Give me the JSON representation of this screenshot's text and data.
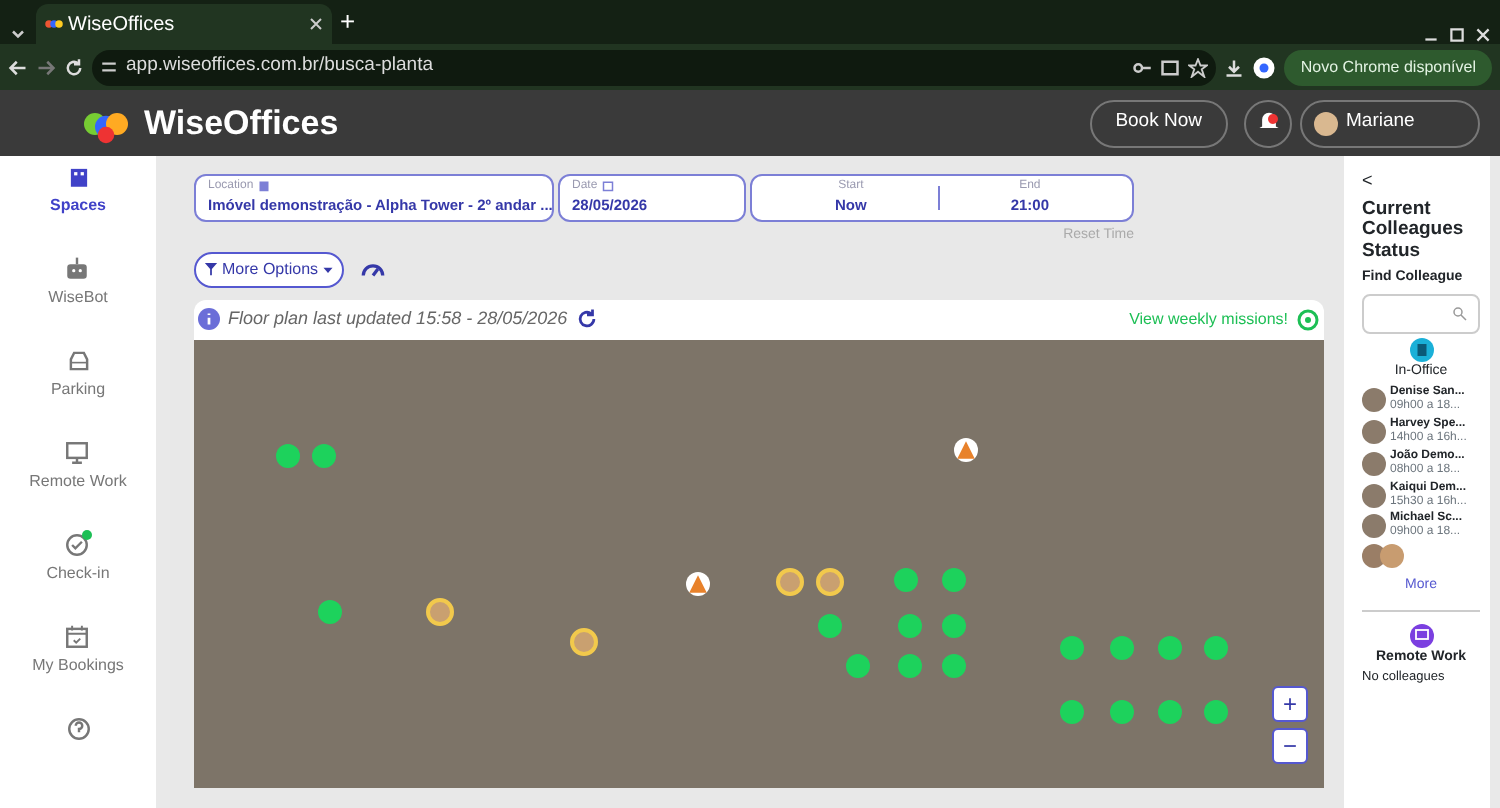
{
  "browser": {
    "tab_title": "WiseOffices",
    "new_tab": "+",
    "url": "app.wiseoffices.com.br/busca-planta",
    "update_label": "Novo Chrome disponível"
  },
  "header": {
    "logo": "WiseOffices",
    "book_button": "Book Now",
    "notification": true,
    "user": "Mariane"
  },
  "sidebar": {
    "items": [
      {
        "label": "Spaces",
        "selected": true,
        "badge": false
      },
      {
        "label": "WiseBot",
        "selected": false,
        "badge": false
      },
      {
        "label": "Parking",
        "selected": false,
        "badge": false
      },
      {
        "label": "Remote Work",
        "selected": false,
        "badge": false
      },
      {
        "label": "Check-in",
        "selected": false,
        "badge": true
      },
      {
        "label": "My Bookings",
        "selected": false,
        "badge": false
      }
    ]
  },
  "filters": {
    "location": {
      "label": "Location",
      "value": "Imóvel demonstração - Alpha Tower - 2º andar ..."
    },
    "date": {
      "label": "Date",
      "value": "28/05/2026"
    },
    "start": {
      "label": "Start",
      "value": "Now"
    },
    "end": {
      "label": "End",
      "value": "21:00"
    },
    "reset": "Reset Time",
    "more_options": "More Options"
  },
  "floor_plan": {
    "updated": "Floor plan last updated 15:58 - 28/05/2026",
    "missions": "View weekly missions!",
    "zoom_in": "+",
    "zoom_out": "−",
    "markers": [
      {
        "kind": "seat"
      },
      {
        "kind": "seat"
      },
      {
        "kind": "seat"
      },
      {
        "kind": "avatar"
      },
      {
        "kind": "avatar"
      },
      {
        "kind": "warning"
      },
      {
        "kind": "warning"
      },
      {
        "kind": "avatar"
      },
      {
        "kind": "avatar"
      },
      {
        "kind": "seat"
      },
      {
        "kind": "seat"
      },
      {
        "kind": "seat"
      },
      {
        "kind": "seat"
      },
      {
        "kind": "seat"
      },
      {
        "kind": "seat"
      },
      {
        "kind": "seat"
      },
      {
        "kind": "seat"
      },
      {
        "kind": "seat"
      },
      {
        "kind": "seat"
      },
      {
        "kind": "seat"
      },
      {
        "kind": "seat"
      },
      {
        "kind": "seat"
      },
      {
        "kind": "seat"
      },
      {
        "kind": "seat"
      },
      {
        "kind": "seat"
      }
    ]
  },
  "colleagues": {
    "back": "<",
    "title": "Current Colleagues Status",
    "find_label": "Find Colleague",
    "in_office_label": "In-Office",
    "people": [
      {
        "name": "Denise San...",
        "time": "09h00 a 18..."
      },
      {
        "name": "Harvey Spe...",
        "time": "14h00 a 16h..."
      },
      {
        "name": "João Demo...",
        "time": "08h00 a 18..."
      },
      {
        "name": "Kaiqui Dem...",
        "time": "15h30 a 16h..."
      },
      {
        "name": "Michael Sc...",
        "time": "09h00 a 18..."
      }
    ],
    "more": "More",
    "remote_label": "Remote Work",
    "remote_status": "No colleagues"
  }
}
